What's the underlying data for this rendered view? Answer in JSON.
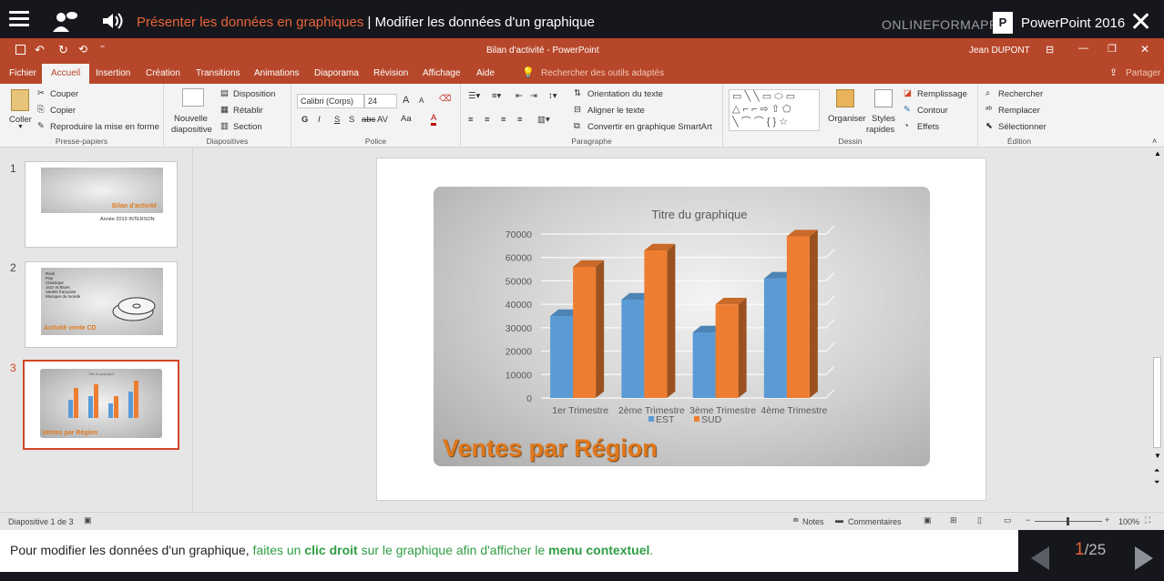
{
  "lesson": {
    "section_title": "Présenter les données en graphiques",
    "separator": "|",
    "page_title": "Modifier les données d'un graphique",
    "brand": "ONLINEFORMAPRO",
    "product": "PowerPoint 2016",
    "product_icon_letter": "P"
  },
  "window": {
    "title": "Bilan d'activité - PowerPoint",
    "user": "Jean DUPONT"
  },
  "menu": {
    "items": [
      "Fichier",
      "Accueil",
      "Insertion",
      "Création",
      "Transitions",
      "Animations",
      "Diaporama",
      "Révision",
      "Affichage",
      "Aide"
    ],
    "search_placeholder": "Rechercher des outils adaptés",
    "share": "Partager"
  },
  "ribbon": {
    "clipboard": {
      "paste": "Coller",
      "cut": "Couper",
      "copy": "Copier",
      "format_painter": "Reproduire la mise en forme",
      "label": "Presse-papiers"
    },
    "slides": {
      "new_slide_1": "Nouvelle",
      "new_slide_2": "diapositive",
      "layout": "Disposition",
      "reset": "Rétablir",
      "section": "Section",
      "label": "Diapositives"
    },
    "font": {
      "name": "Calibri (Corps)",
      "size": "24",
      "bold": "G",
      "italic": "I",
      "underline": "S",
      "shadow": "S",
      "strike": "abc",
      "spacing": "AV",
      "case": "Aa",
      "color": "A",
      "grow": "A",
      "shrink": "A",
      "label": "Police"
    },
    "paragraph": {
      "text_direction": "Orientation du texte",
      "align_text": "Aligner le texte",
      "smartart": "Convertir en graphique SmartArt",
      "label": "Paragraphe"
    },
    "drawing": {
      "arrange": "Organiser",
      "quick_styles_1": "Styles",
      "quick_styles_2": "rapides",
      "fill": "Remplissage",
      "outline": "Contour",
      "effects": "Effets",
      "label": "Dessin"
    },
    "editing": {
      "find": "Rechercher",
      "replace": "Remplacer",
      "select": "Sélectionner",
      "label": "Édition"
    }
  },
  "thumbnails": [
    {
      "num": "1",
      "title": "Bilan d'activité",
      "subtitle": "Année 2019 INTERSON"
    },
    {
      "num": "2",
      "lines": [
        "Rock",
        "Pop",
        "Classique",
        "Jazz et Blues",
        "Variété française",
        "Musique du monde"
      ],
      "title": "Activité vente CD"
    },
    {
      "num": "3",
      "chart_title": "Titre du graphique",
      "title": "Ventes par Région"
    }
  ],
  "slide": {
    "title": "Ventes par Région"
  },
  "chart_data": {
    "type": "bar",
    "title": "Titre du graphique",
    "categories": [
      "1er Trimestre",
      "2ème Trimestre",
      "3ème Trimestre",
      "4ème Trimestre"
    ],
    "series": [
      {
        "name": "EST",
        "values": [
          35000,
          42000,
          28000,
          51000
        ],
        "color": "#5b9bd5"
      },
      {
        "name": "SUD",
        "values": [
          56000,
          63000,
          40000,
          69000
        ],
        "color": "#ed7d31"
      }
    ],
    "yticks": [
      "0",
      "10000",
      "20000",
      "30000",
      "40000",
      "50000",
      "60000",
      "70000"
    ],
    "ylim": [
      0,
      70000
    ],
    "grid": true,
    "legend": "bottom"
  },
  "status": {
    "slide_info": "Diapositive 1 de 3",
    "notes": "Notes",
    "comments": "Commentaires",
    "zoom": "100%"
  },
  "instruction": {
    "part1": "Pour modifier les données d'un graphique, ",
    "part2": "faites un ",
    "part3": "clic droit",
    "part4": " sur le graphique afin d'afficher le ",
    "part5": "menu contextuel",
    "part6": "."
  },
  "pager": {
    "current": "1",
    "total": "/25"
  },
  "colors": {
    "accent": "#b7472a",
    "orange": "#e9643a",
    "green": "#2f9e44"
  }
}
